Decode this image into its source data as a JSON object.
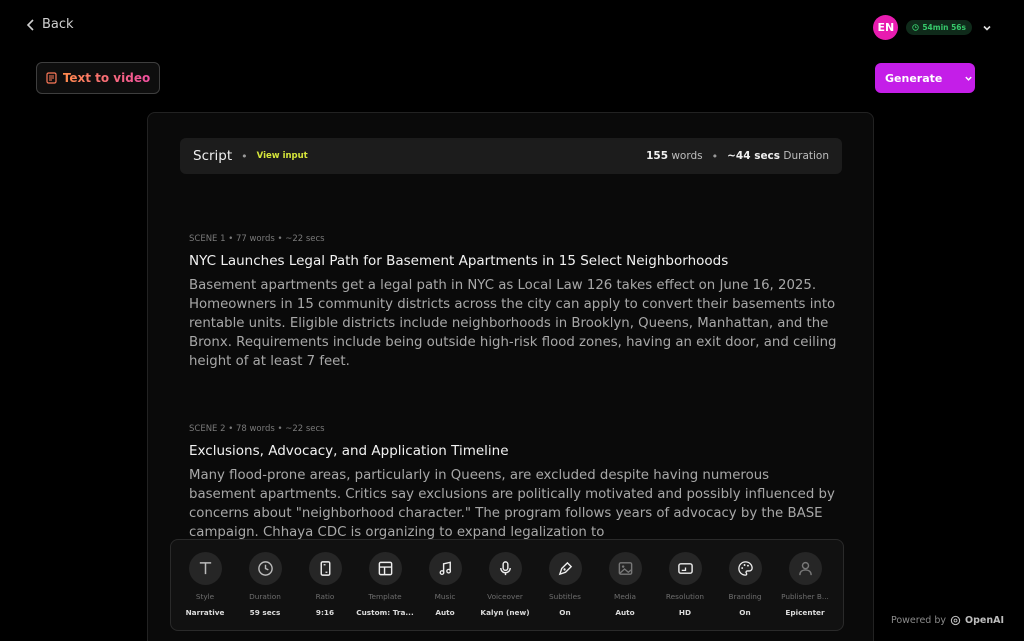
{
  "nav": {
    "back_label": "Back"
  },
  "user": {
    "initials": "EN",
    "time_left": "54min 56s"
  },
  "mode": {
    "label": "Text to video"
  },
  "generate": {
    "label": "Generate"
  },
  "script": {
    "title": "Script",
    "view_input": "View input",
    "words_count": "155",
    "words_label": "words",
    "duration_value": "~44 secs",
    "duration_label": "Duration"
  },
  "scenes": [
    {
      "meta": "SCENE 1 • 77 words • ~22 secs",
      "title": "NYC Launches Legal Path for Basement Apartments in 15 Select Neighborhoods",
      "body": "Basement apartments get a legal path in NYC as Local Law 126 takes effect on June 16, 2025. Homeowners in 15 community districts across the city can apply to convert their basements into rentable units. Eligible districts include neighborhoods in Brooklyn, Queens, Manhattan, and the Bronx. Requirements include being outside high-risk flood zones, having an exit door, and ceiling height of at least 7 feet."
    },
    {
      "meta": "SCENE 2 • 78 words • ~22 secs",
      "title": "Exclusions, Advocacy, and Application Timeline",
      "body": "Many flood-prone areas, particularly in Queens, are excluded despite having numerous basement apartments. Critics say exclusions are politically motivated and possibly influenced by concerns about \"neighborhood character.\" The program follows years of advocacy by the BASE campaign. Chhaya CDC is organizing to expand legalization to"
    }
  ],
  "toolbar": [
    {
      "name": "style",
      "icon": "text-icon",
      "label": "Style",
      "value": "Narrative"
    },
    {
      "name": "duration",
      "icon": "clock-icon",
      "label": "Duration",
      "value": "59 secs"
    },
    {
      "name": "ratio",
      "icon": "ratio-icon",
      "label": "Ratio",
      "value": "9:16"
    },
    {
      "name": "template",
      "icon": "template-icon",
      "label": "Template",
      "value": "Custom: Tra..."
    },
    {
      "name": "music",
      "icon": "music-icon",
      "label": "Music",
      "value": "Auto"
    },
    {
      "name": "voiceover",
      "icon": "microphone-icon",
      "label": "Voiceover",
      "value": "Kalyn (new)"
    },
    {
      "name": "subtitles",
      "icon": "pen-icon",
      "label": "Subtitles",
      "value": "On"
    },
    {
      "name": "media",
      "icon": "image-icon",
      "label": "Media",
      "value": "Auto"
    },
    {
      "name": "resolution",
      "icon": "screen-icon",
      "label": "Resolution",
      "value": "HD"
    },
    {
      "name": "branding",
      "icon": "palette-icon",
      "label": "Branding",
      "value": "On"
    },
    {
      "name": "publisher",
      "icon": "user-icon",
      "label": "Publisher B...",
      "value": "Epicenter"
    }
  ],
  "footer": {
    "powered_by": "Powered by",
    "brand": "OpenAI"
  }
}
